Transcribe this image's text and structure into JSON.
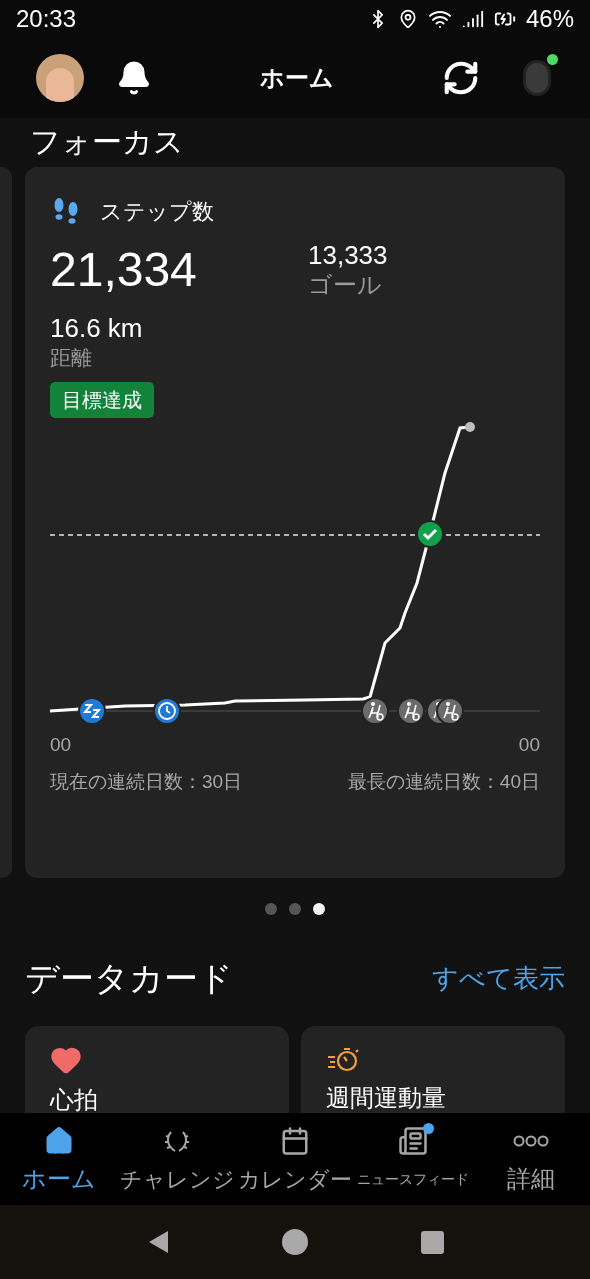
{
  "status_bar": {
    "time": "20:33",
    "battery": "46%"
  },
  "header": {
    "title": "ホーム",
    "device_connected": true
  },
  "section_title": "フォーカス",
  "steps_card": {
    "title": "ステップ数",
    "value": "21,334",
    "goal_value": "13,333",
    "goal_label": "ゴール",
    "distance": "16.6 km",
    "distance_label": "距離",
    "badge": "目標達成",
    "goal_reached": true,
    "chart": {
      "x_start": "00",
      "x_end": "00",
      "markers": [
        {
          "kind": "sleep"
        },
        {
          "kind": "clock"
        },
        {
          "kind": "bike"
        },
        {
          "kind": "bike"
        },
        {
          "kind": "bike"
        },
        {
          "kind": "bike"
        }
      ]
    },
    "current_streak": "現在の連続日数：30日",
    "longest_streak": "最長の連続日数：40日"
  },
  "pager": [
    {
      "selected": false
    },
    {
      "selected": false
    },
    {
      "selected": true
    }
  ],
  "data_cards": {
    "title": "データカード",
    "link": "すべて表示",
    "cards": [
      {
        "kind": "heart",
        "title": "心拍"
      },
      {
        "kind": "intensity",
        "title": "週間運動量"
      }
    ]
  },
  "nav": [
    {
      "kind": "home",
      "label": "ホーム",
      "selected": true,
      "dot": false
    },
    {
      "kind": "challenge",
      "label": "チャレンジ",
      "selected": false,
      "dot": false
    },
    {
      "kind": "calendar",
      "label": "カレンダー",
      "selected": false,
      "dot": false
    },
    {
      "kind": "news",
      "label": "ニュースフィード",
      "selected": false,
      "dot": true
    },
    {
      "kind": "more",
      "label": "詳細",
      "selected": false,
      "dot": false
    }
  ]
}
